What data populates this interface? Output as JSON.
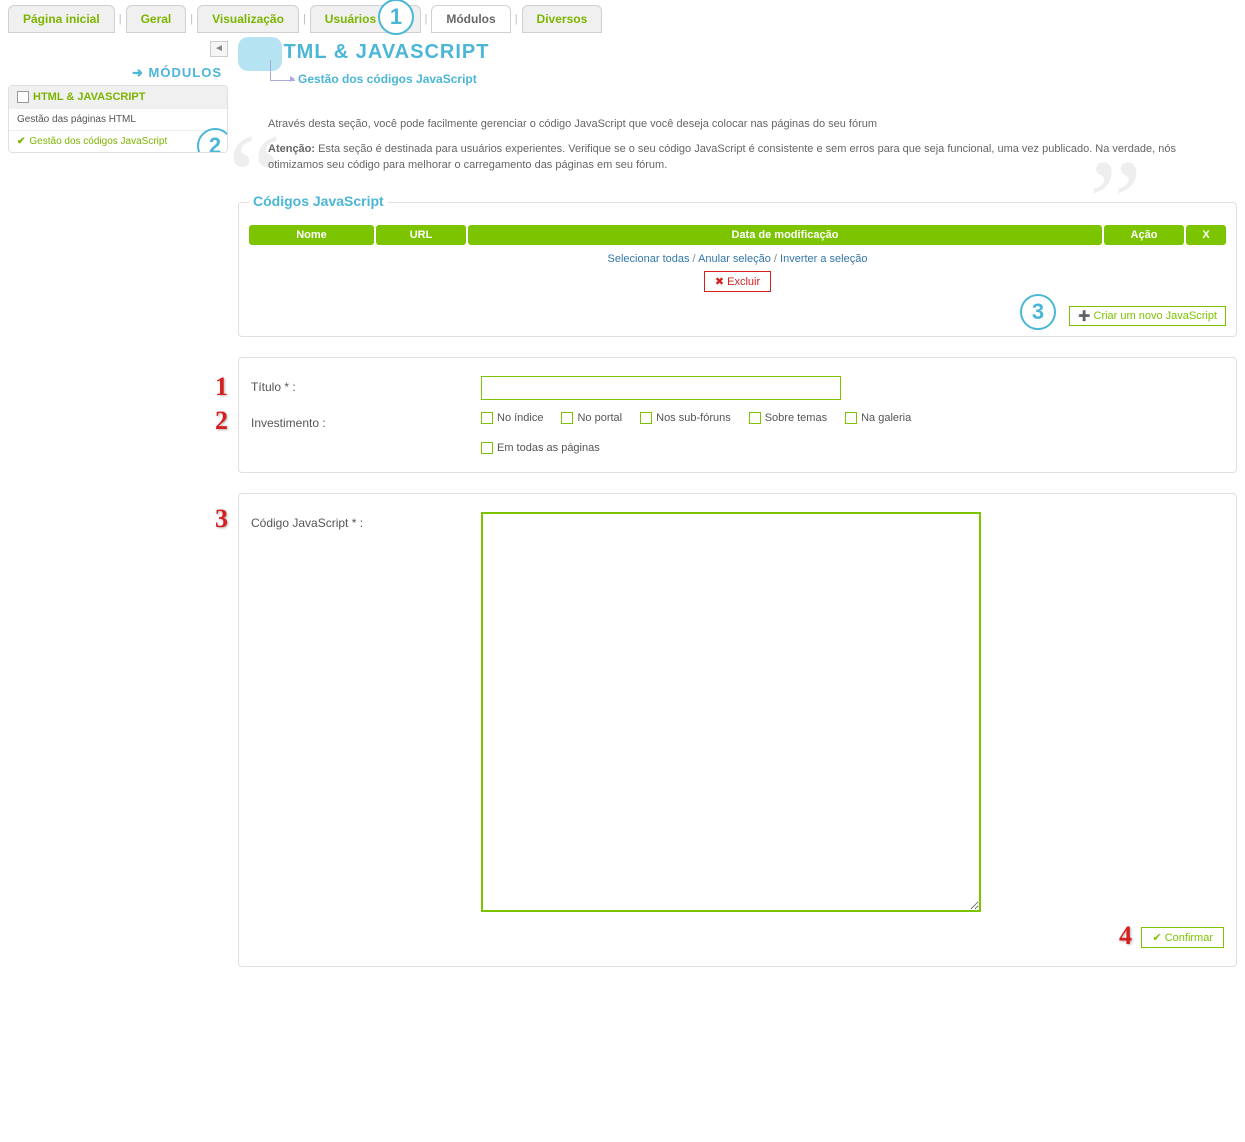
{
  "tabs": {
    "items": [
      "Página inicial",
      "Geral",
      "Visualização",
      "Usuários & Gr",
      "Módulos",
      "Diversos"
    ],
    "active_index": 4
  },
  "sidebar": {
    "back_title": "MÓDULOS",
    "header": "HTML & JAVASCRIPT",
    "items": [
      {
        "label": "Gestão das páginas HTML",
        "active": false
      },
      {
        "label": "Gestão dos códigos JavaScript",
        "active": true
      }
    ]
  },
  "header": {
    "title": "HTML & JAVASCRIPT",
    "subtitle": "Gestão dos códigos JavaScript"
  },
  "intro": {
    "p1": "Através desta seção, você pode facilmente gerenciar o código JavaScript que você deseja colocar nas páginas do seu fórum",
    "p2_label": "Atenção:",
    "p2_text": " Esta seção é destinada para usuários experientes. Verifique se o seu código JavaScript é consistente e sem erros para que seja funcional, uma vez publicado. Na verdade, nós otimizamos seu código para melhorar o carregamento das páginas em seu fórum."
  },
  "js_panel": {
    "legend": "Códigos JavaScript",
    "cols": {
      "nome": "Nome",
      "url": "URL",
      "data": "Data de modificação",
      "acao": "Ação",
      "x": "X"
    },
    "links": {
      "select_all": "Selecionar todas",
      "deselect": "Anular seleção",
      "invert": "Inverter a seleção"
    },
    "delete_btn": "Excluir",
    "create_btn": "Criar um novo JavaScript"
  },
  "form": {
    "titulo_label": "Título * :",
    "invest_label": "Investimento :",
    "checkboxes": [
      "No índice",
      "No portal",
      "Nos sub-fóruns",
      "Sobre temas",
      "Na galeria",
      "Em todas as páginas"
    ],
    "code_label": "Código JavaScript * :",
    "confirm_btn": "Confirmar"
  },
  "callouts": {
    "c1": "1",
    "c2": "2",
    "c3": "3",
    "r1": "1",
    "r2": "2",
    "r3": "3",
    "r4": "4"
  }
}
